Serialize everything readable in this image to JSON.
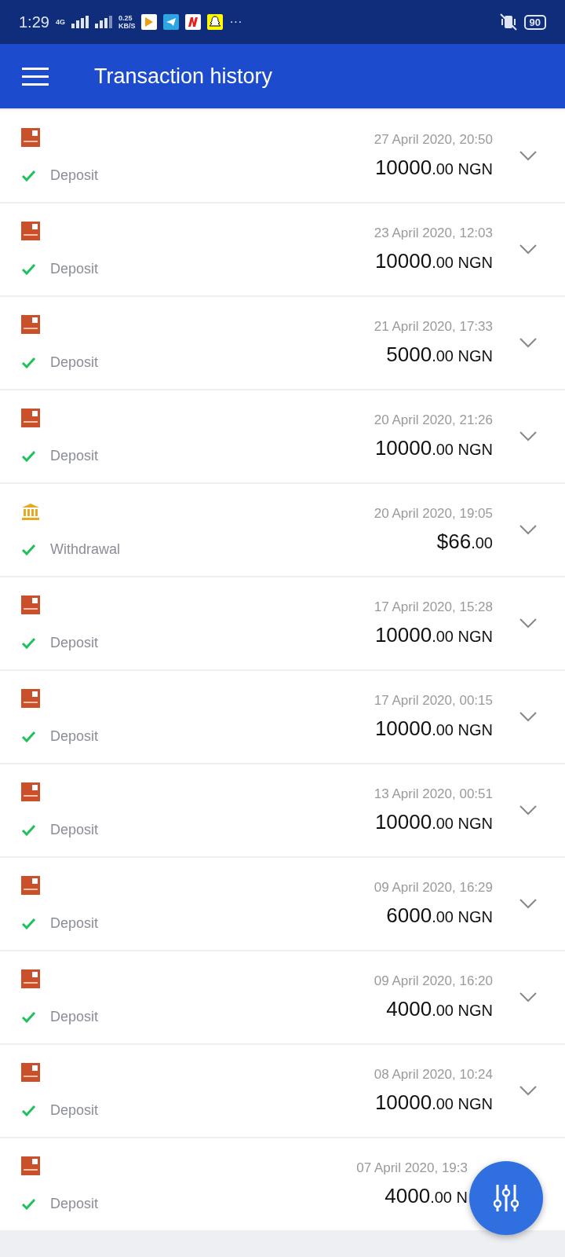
{
  "status_bar": {
    "time": "1:29",
    "network": "4G",
    "speed": "0.25",
    "speed_unit": "KB/S",
    "more": "···",
    "battery": "90"
  },
  "app_bar": {
    "title": "Transaction history"
  },
  "transactions": [
    {
      "kind": "card",
      "type": "Deposit",
      "date": "27 April 2020, 20:50",
      "whole": "10000",
      "fraction": ".00 NGN"
    },
    {
      "kind": "card",
      "type": "Deposit",
      "date": "23 April 2020, 12:03",
      "whole": "10000",
      "fraction": ".00 NGN"
    },
    {
      "kind": "card",
      "type": "Deposit",
      "date": "21 April 2020, 17:33",
      "whole": "5000",
      "fraction": ".00 NGN"
    },
    {
      "kind": "card",
      "type": "Deposit",
      "date": "20 April 2020, 21:26",
      "whole": "10000",
      "fraction": ".00 NGN"
    },
    {
      "kind": "bank",
      "type": "Withdrawal",
      "date": "20 April 2020, 19:05",
      "whole": "$66",
      "fraction": ".00"
    },
    {
      "kind": "card",
      "type": "Deposit",
      "date": "17 April 2020, 15:28",
      "whole": "10000",
      "fraction": ".00 NGN"
    },
    {
      "kind": "card",
      "type": "Deposit",
      "date": "17 April 2020, 00:15",
      "whole": "10000",
      "fraction": ".00 NGN"
    },
    {
      "kind": "card",
      "type": "Deposit",
      "date": "13 April 2020, 00:51",
      "whole": "10000",
      "fraction": ".00 NGN"
    },
    {
      "kind": "card",
      "type": "Deposit",
      "date": "09 April 2020, 16:29",
      "whole": "6000",
      "fraction": ".00 NGN"
    },
    {
      "kind": "card",
      "type": "Deposit",
      "date": "09 April 2020, 16:20",
      "whole": "4000",
      "fraction": ".00 NGN"
    },
    {
      "kind": "card",
      "type": "Deposit",
      "date": "08 April 2020, 10:24",
      "whole": "10000",
      "fraction": ".00 NGN"
    },
    {
      "kind": "card",
      "type": "Deposit",
      "date": "07 April 2020, 19:3",
      "whole": "4000",
      "fraction": ".00 N"
    }
  ]
}
